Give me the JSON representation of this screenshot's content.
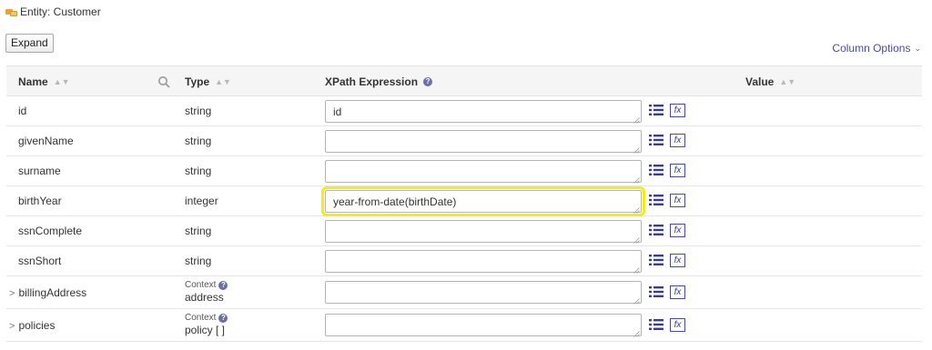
{
  "entity": {
    "label": "Entity: Customer"
  },
  "toolbar": {
    "expand_label": "Expand",
    "column_options_label": "Column Options"
  },
  "columns": {
    "name": "Name",
    "type": "Type",
    "xpath": "XPath Expression",
    "value": "Value"
  },
  "context_label": "Context",
  "rows": [
    {
      "name": "id",
      "type": "string",
      "xpath": "id",
      "expandable": false,
      "context": false
    },
    {
      "name": "givenName",
      "type": "string",
      "xpath": "",
      "expandable": false,
      "context": false
    },
    {
      "name": "surname",
      "type": "string",
      "xpath": "",
      "expandable": false,
      "context": false
    },
    {
      "name": "birthYear",
      "type": "integer",
      "xpath": "year-from-date(birthDate)",
      "expandable": false,
      "context": false,
      "highlighted": true
    },
    {
      "name": "ssnComplete",
      "type": "string",
      "xpath": "",
      "expandable": false,
      "context": false
    },
    {
      "name": "ssnShort",
      "type": "string",
      "xpath": "",
      "expandable": false,
      "context": false
    },
    {
      "name": "billingAddress",
      "type": "address",
      "xpath": "",
      "expandable": true,
      "context": true
    },
    {
      "name": "policies",
      "type": "policy [ ]",
      "xpath": "",
      "expandable": true,
      "context": true
    }
  ],
  "icons": {
    "entity": "entity-icon",
    "search": "search-icon",
    "list": "list-icon",
    "fx": "fx",
    "help": "help-icon"
  },
  "colors": {
    "accent": "#4a4aa0",
    "highlight": "#f2ef10",
    "header_bg": "#f5f5f5"
  }
}
